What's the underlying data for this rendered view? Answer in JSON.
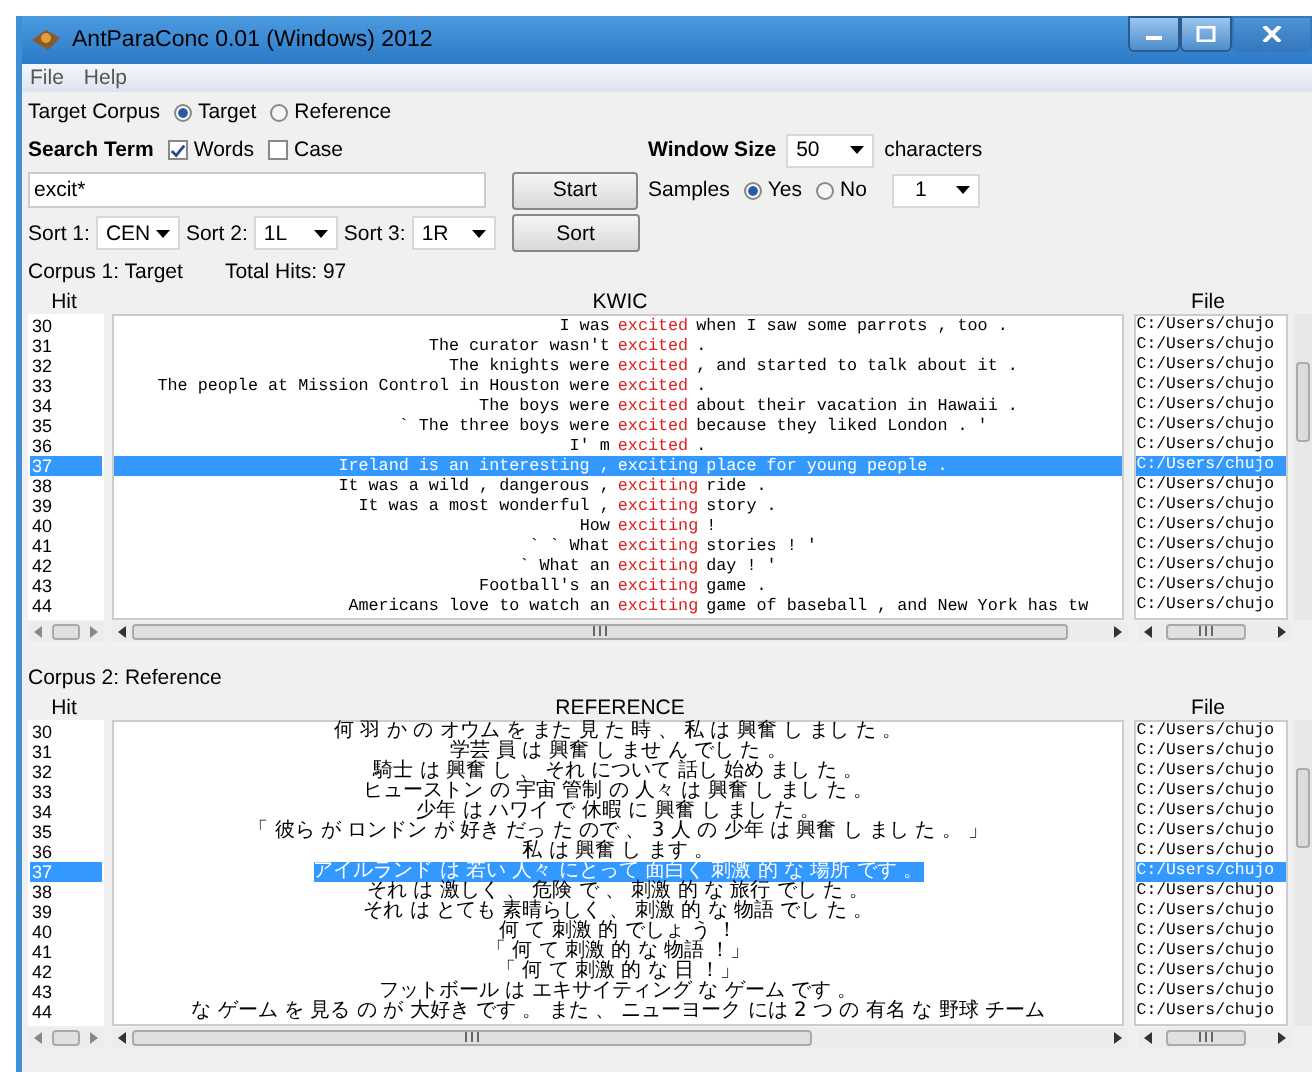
{
  "window": {
    "title": "AntParaConc 0.01 (Windows) 2012"
  },
  "menu": [
    "File",
    "Help"
  ],
  "target_corpus": {
    "label": "Target Corpus",
    "options": [
      {
        "label": "Target",
        "selected": true
      },
      {
        "label": "Reference",
        "selected": false
      }
    ]
  },
  "search_term": {
    "label": "Search Term",
    "checkboxes": [
      {
        "label": "Words",
        "checked": true
      },
      {
        "label": "Case",
        "checked": false
      }
    ],
    "value": "excit*"
  },
  "window_size": {
    "label": "Window Size",
    "value": "50",
    "unit": "characters"
  },
  "samples": {
    "label": "Samples",
    "options": [
      {
        "label": "Yes",
        "selected": true
      },
      {
        "label": "No",
        "selected": false
      }
    ],
    "count": "1"
  },
  "sorts": [
    {
      "label": "Sort 1:",
      "value": "CEN"
    },
    {
      "label": "Sort 2:",
      "value": "1L"
    },
    {
      "label": "Sort 3:",
      "value": "1R"
    }
  ],
  "buttons": {
    "start": "Start",
    "sort": "Sort"
  },
  "corpus1": {
    "label": "Corpus 1: Target",
    "total_hits": "Total Hits: 97",
    "columns": [
      "Hit",
      "KWIC",
      "File"
    ],
    "rows": [
      {
        "hit": "30",
        "left": "I was",
        "key": "excited",
        "right": "when I saw some parrots , too .",
        "file": "C:/Users/chujo",
        "selected": false
      },
      {
        "hit": "31",
        "left": "The curator wasn't",
        "key": "excited",
        "right": ".",
        "file": "C:/Users/chujo",
        "selected": false
      },
      {
        "hit": "32",
        "left": "The knights were",
        "key": "excited",
        "right": ", and started to talk about it .",
        "file": "C:/Users/chujo",
        "selected": false
      },
      {
        "hit": "33",
        "left": "The people at Mission Control in Houston were",
        "key": "excited",
        "right": ".",
        "file": "C:/Users/chujo",
        "selected": false
      },
      {
        "hit": "34",
        "left": "The boys were",
        "key": "excited",
        "right": "about their vacation in Hawaii .",
        "file": "C:/Users/chujo",
        "selected": false
      },
      {
        "hit": "35",
        "left": "` The three boys were",
        "key": "excited",
        "right": "because they liked London . '",
        "file": "C:/Users/chujo",
        "selected": false
      },
      {
        "hit": "36",
        "left": "I' m",
        "key": "excited",
        "right": ".",
        "file": "C:/Users/chujo",
        "selected": false
      },
      {
        "hit": "37",
        "left": "Ireland is an interesting ,",
        "key": "exciting",
        "right": "place for young people .",
        "file": "C:/Users/chujo",
        "selected": true
      },
      {
        "hit": "38",
        "left": "It was a wild , dangerous ,",
        "key": "exciting",
        "right": "ride .",
        "file": "C:/Users/chujo",
        "selected": false
      },
      {
        "hit": "39",
        "left": "It was a most wonderful ,",
        "key": "exciting",
        "right": "story .",
        "file": "C:/Users/chujo",
        "selected": false
      },
      {
        "hit": "40",
        "left": "How",
        "key": "exciting",
        "right": "!",
        "file": "C:/Users/chujo",
        "selected": false
      },
      {
        "hit": "41",
        "left": "` ` What",
        "key": "exciting",
        "right": "stories ! '",
        "file": "C:/Users/chujo",
        "selected": false
      },
      {
        "hit": "42",
        "left": "` What an",
        "key": "exciting",
        "right": "day ! '",
        "file": "C:/Users/chujo",
        "selected": false
      },
      {
        "hit": "43",
        "left": "Football's an",
        "key": "exciting",
        "right": "game .",
        "file": "C:/Users/chujo",
        "selected": false
      },
      {
        "hit": "44",
        "left": "Americans love to watch an",
        "key": "exciting",
        "right": "game of baseball , and New York has tw",
        "file": "C:/Users/chujo",
        "selected": false
      }
    ]
  },
  "corpus2": {
    "label": "Corpus 2: Reference",
    "columns": [
      "Hit",
      "REFERENCE",
      "File"
    ],
    "rows": [
      {
        "hit": "30",
        "text": "何 羽 か の オウム を また 見 た 時 、 私 は 興奮 し まし た 。",
        "file": "C:/Users/chujo",
        "selected": false
      },
      {
        "hit": "31",
        "text": "学芸 員 は 興奮 し ませ ん でし た 。",
        "file": "C:/Users/chujo",
        "selected": false
      },
      {
        "hit": "32",
        "text": "騎士 は 興奮 し 、 それ について 話し 始め まし た 。",
        "file": "C:/Users/chujo",
        "selected": false
      },
      {
        "hit": "33",
        "text": "ヒューストン の 宇宙 管制 の 人々 は 興奮 し まし た 。",
        "file": "C:/Users/chujo",
        "selected": false
      },
      {
        "hit": "34",
        "text": "少年 は ハワイ で 休暇 に 興奮 し まし た 。",
        "file": "C:/Users/chujo",
        "selected": false
      },
      {
        "hit": "35",
        "text": "「 彼ら が ロンドン が 好き だっ た ので 、 3 人 の 少年 は 興奮 し まし た 。 」",
        "file": "C:/Users/chujo",
        "selected": false
      },
      {
        "hit": "36",
        "text": "私 は 興奮 し ます 。",
        "file": "C:/Users/chujo",
        "selected": false
      },
      {
        "hit": "37",
        "text": "アイルランド は 若い 人々 にとって 面白く 刺激 的 な 場所 です 。",
        "file": "C:/Users/chujo",
        "selected": true
      },
      {
        "hit": "38",
        "text": "それ は 激しく 、 危険 で 、 刺激 的 な 旅行 でし た 。",
        "file": "C:/Users/chujo",
        "selected": false
      },
      {
        "hit": "39",
        "text": "それ は とても 素晴らしく 、 刺激 的 な 物語 でし た 。",
        "file": "C:/Users/chujo",
        "selected": false
      },
      {
        "hit": "40",
        "text": "何 て 刺激 的 でしょ う ！",
        "file": "C:/Users/chujo",
        "selected": false
      },
      {
        "hit": "41",
        "text": "「 何 て 刺激 的 な 物語 ！」",
        "file": "C:/Users/chujo",
        "selected": false
      },
      {
        "hit": "42",
        "text": "「 何 て 刺激 的 な 日 ！」",
        "file": "C:/Users/chujo",
        "selected": false
      },
      {
        "hit": "43",
        "text": "フットボール は エキサイティング な ゲーム です 。",
        "file": "C:/Users/chujo",
        "selected": false
      },
      {
        "hit": "44",
        "text": "な ゲーム を 見る の が 大好き です 。 また 、 ニューヨーク には 2 つ の 有名 な 野球 チーム",
        "file": "C:/Users/chujo",
        "selected": false
      }
    ]
  }
}
